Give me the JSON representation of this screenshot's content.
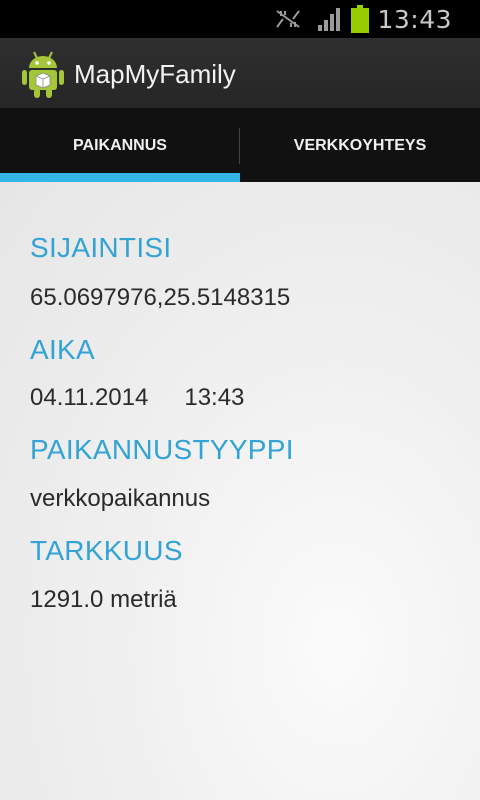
{
  "status_bar": {
    "time": "13:43",
    "icons": [
      "no-signal-icon",
      "signal-bars-icon",
      "battery-icon"
    ],
    "battery_color": "#99cc00"
  },
  "app": {
    "title": "MapMyFamily",
    "icon": "android-robot-icon"
  },
  "tabs": [
    {
      "label": "PAIKANNUS",
      "selected": true
    },
    {
      "label": "VERKKOYHTEYS",
      "selected": false
    }
  ],
  "fields": {
    "location": {
      "label": "SIJAINTISI",
      "value": "65.0697976,25.5148315"
    },
    "time": {
      "label": "AIKA",
      "date": "04.11.2014",
      "time": "13:43"
    },
    "type": {
      "label": "PAIKANNUSTYYPPI",
      "value": "verkkopaikannus"
    },
    "accuracy": {
      "label": "TARKKUUS",
      "value": "1291.0 metriä"
    }
  },
  "colors": {
    "accent": "#33b5e5",
    "label": "#33a3d6",
    "text": "#2a2a2a"
  }
}
